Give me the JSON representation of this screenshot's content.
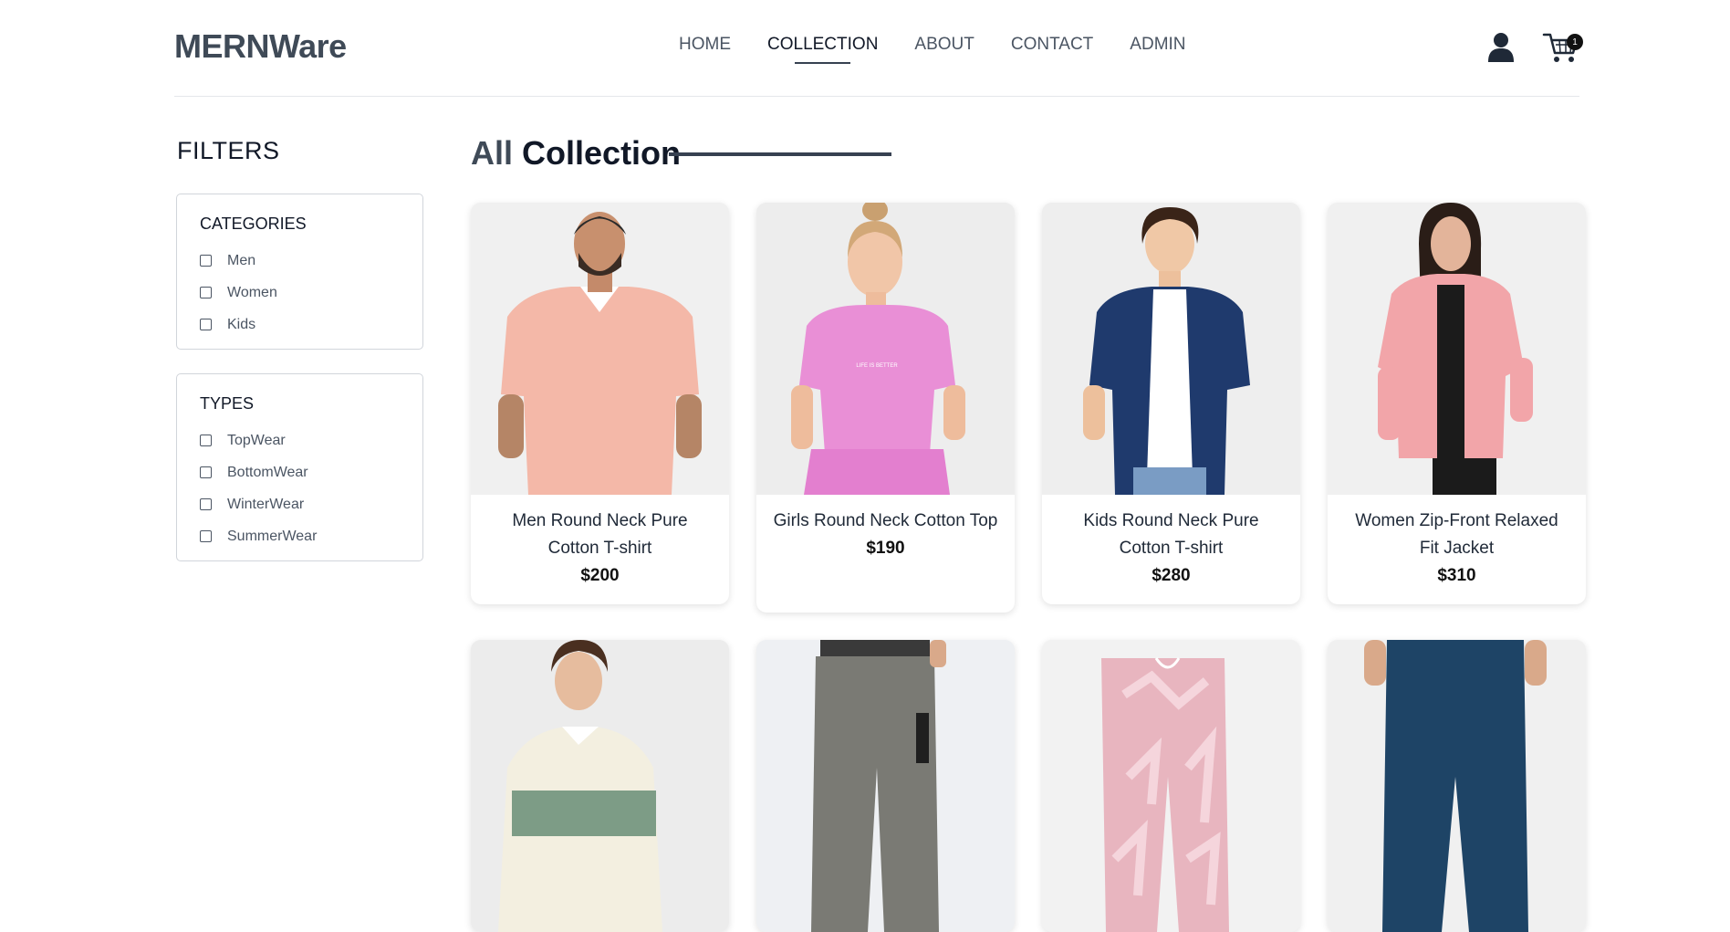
{
  "header": {
    "logo": "MERNWare",
    "nav": [
      "HOME",
      "COLLECTION",
      "ABOUT",
      "CONTACT",
      "ADMIN"
    ],
    "active_nav": "COLLECTION",
    "cart_count": "1",
    "icons": [
      "user-icon",
      "cart-icon"
    ]
  },
  "filters": {
    "title": "FILTERS",
    "categories": {
      "heading": "CATEGORIES",
      "options": [
        "Men",
        "Women",
        "Kids"
      ]
    },
    "types": {
      "heading": "TYPES",
      "options": [
        "TopWear",
        "BottomWear",
        "WinterWear",
        "SummerWear"
      ]
    }
  },
  "collection": {
    "title_part1": "All",
    "title_part2": "Collection",
    "products": [
      {
        "name": "Men Round Neck Pure Cotton T-shirt",
        "price": "$200"
      },
      {
        "name": "Girls Round Neck Cotton Top",
        "price": "$190"
      },
      {
        "name": "Kids Round Neck Pure Cotton T-shirt",
        "price": "$280"
      },
      {
        "name": "Women Zip-Front Relaxed Fit Jacket",
        "price": "$310"
      },
      {
        "name": "",
        "price": ""
      },
      {
        "name": "",
        "price": ""
      },
      {
        "name": "",
        "price": ""
      },
      {
        "name": "",
        "price": ""
      }
    ]
  },
  "colors": {
    "accent": "#111827",
    "logo": "#3f4a57"
  }
}
